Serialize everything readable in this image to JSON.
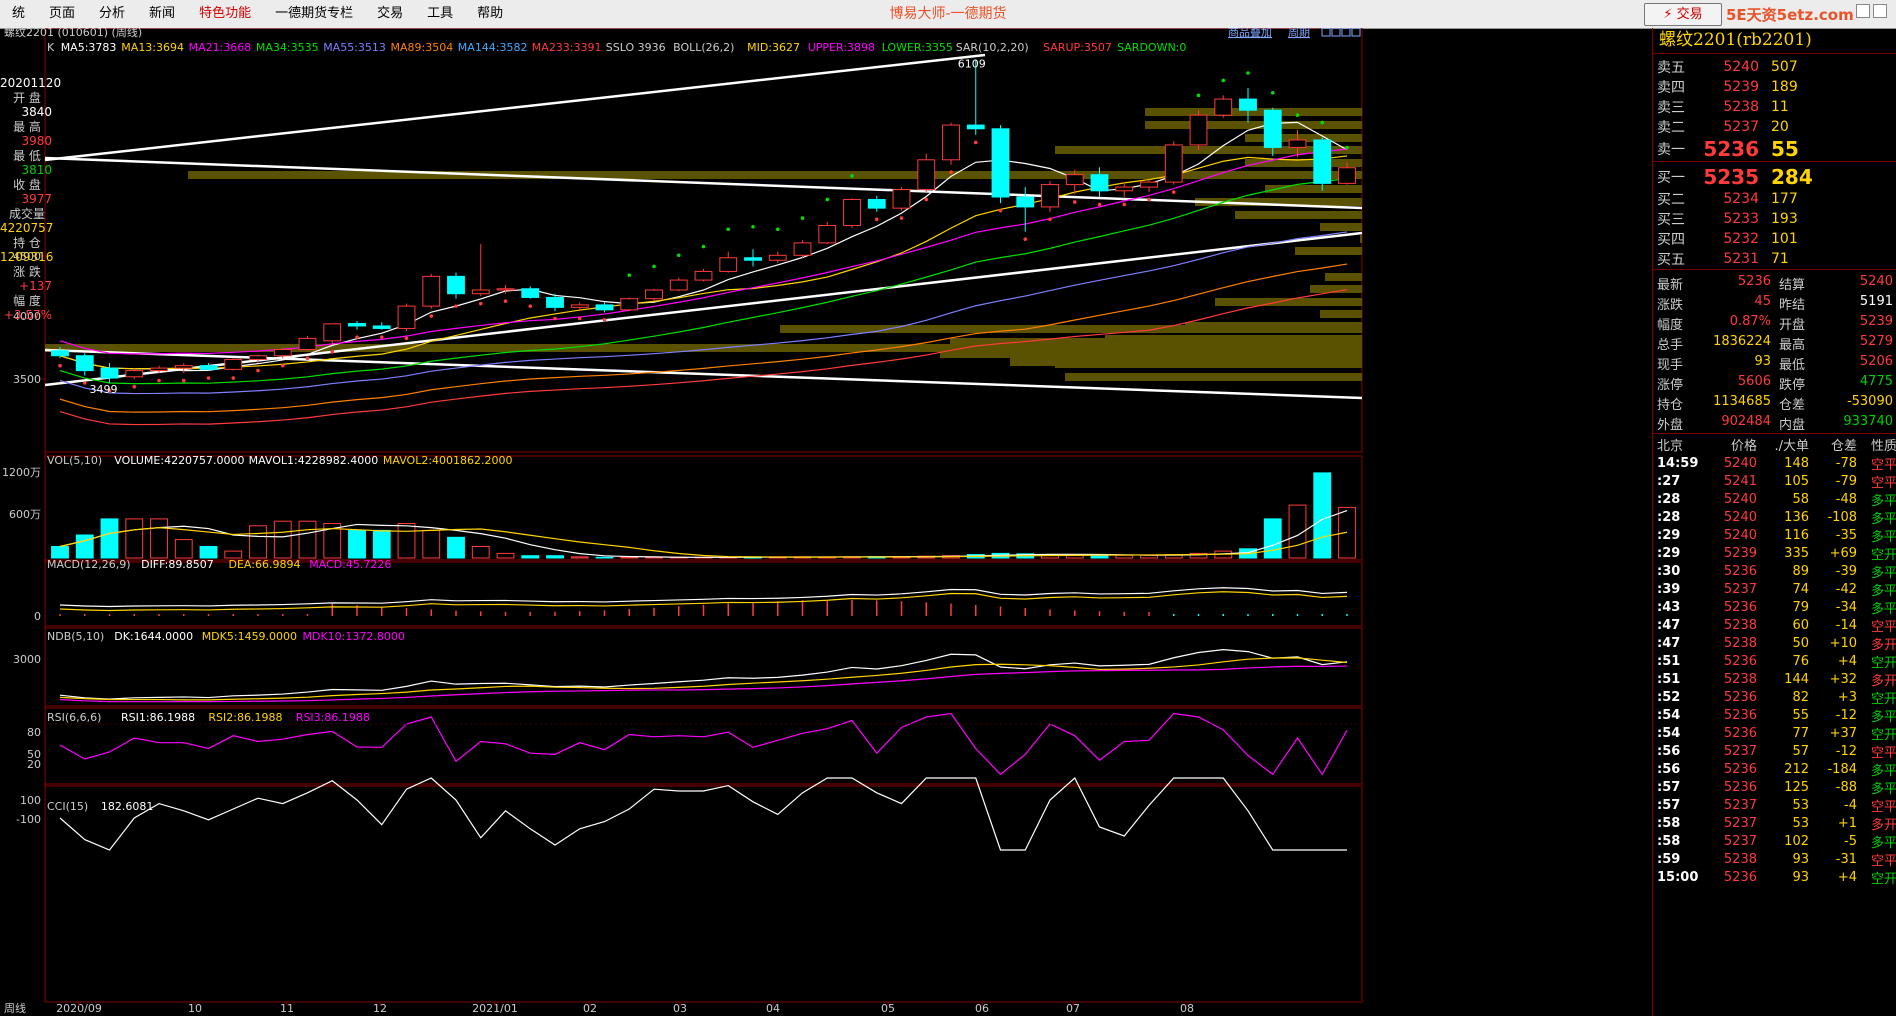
{
  "menu": {
    "items": [
      "统",
      "页面",
      "分析",
      "新闻",
      "特色功能",
      "一德期货专栏",
      "交易",
      "工具",
      "帮助"
    ],
    "app_title": "博易大师-一德期货",
    "trade_button": "交易",
    "watermark": "5E天资5etz.com"
  },
  "chart_header": {
    "title": "螺纹2201 (010601) (周线)",
    "links": [
      "商品叠加",
      "周期"
    ]
  },
  "ohlc": {
    "date": "20201120",
    "rows": [
      {
        "label": "开 盘",
        "value": "3840",
        "color": "#ffffff"
      },
      {
        "label": "最 高",
        "value": "3980",
        "color": "#ff3b3b"
      },
      {
        "label": "最 低",
        "value": "3810",
        "color": "#00d000"
      },
      {
        "label": "收 盘",
        "value": "3977",
        "color": "#ff3b3b"
      },
      {
        "label": "成交量",
        "value": "4220757",
        "color": "#ffd400"
      },
      {
        "label": "持 仓",
        "value": "1209316",
        "color": "#ffd400"
      },
      {
        "label": "涨 跌",
        "value": "+137",
        "color": "#ff3b3b"
      },
      {
        "label": "幅 度",
        "value": "+3.57%",
        "color": "#ff3b3b"
      }
    ]
  },
  "indicators": {
    "ma": [
      {
        "text": "K",
        "color": "#cccccc"
      },
      {
        "text": "MA5:3783",
        "color": "#ffffff"
      },
      {
        "text": "MA13:3694",
        "color": "#ffd400"
      },
      {
        "text": "MA21:3668",
        "color": "#ff00ff"
      },
      {
        "text": "MA34:3535",
        "color": "#00e000"
      },
      {
        "text": "MA55:3513",
        "color": "#7f7fff"
      },
      {
        "text": "MA89:3504",
        "color": "#ff8000"
      },
      {
        "text": "MA144:3582",
        "color": "#3fa9ff"
      },
      {
        "text": "MA233:3391",
        "color": "#ff3b3b"
      },
      {
        "text": "SSLO 3936",
        "color": "#cccccc"
      },
      {
        "text": "BOLL(26,2)",
        "color": "#cccccc"
      },
      {
        "text": "MID:3627",
        "color": "#ffd400"
      },
      {
        "text": "UPPER:3898",
        "color": "#ff00ff"
      },
      {
        "text": "LOWER:3355",
        "color": "#00e000"
      },
      {
        "text": "SAR(10,2,20)",
        "color": "#cccccc"
      },
      {
        "text": "SARUP:3507",
        "color": "#ff3b3b"
      },
      {
        "text": "SARDOWN:0",
        "color": "#00e000"
      }
    ],
    "vol": [
      {
        "text": "VOL(5,10)",
        "color": "#cccccc"
      },
      {
        "text": "VOLUME:4220757.0000",
        "color": "#ffffff"
      },
      {
        "text": "MAVOL1:4228982.4000",
        "color": "#ffffff"
      },
      {
        "text": "MAVOL2:4001862.2000",
        "color": "#ffd400"
      }
    ],
    "macd": [
      {
        "text": "MACD(12,26,9)",
        "color": "#cccccc"
      },
      {
        "text": "DIFF:89.8507",
        "color": "#ffffff"
      },
      {
        "text": "DEA:66.9894",
        "color": "#ffd400"
      },
      {
        "text": "MACD:45.7226",
        "color": "#ff00ff"
      }
    ],
    "ndb": [
      {
        "text": "NDB(5,10)",
        "color": "#cccccc"
      },
      {
        "text": "DK:1644.0000",
        "color": "#ffffff"
      },
      {
        "text": "MDK5:1459.0000",
        "color": "#ffd400"
      },
      {
        "text": "MDK10:1372.8000",
        "color": "#ff00ff"
      }
    ],
    "rsi": [
      {
        "text": "RSI(6,6,6)",
        "color": "#cccccc"
      },
      {
        "text": "RSI1:86.1988",
        "color": "#ffffff"
      },
      {
        "text": "RSI2:86.1988",
        "color": "#ffd400"
      },
      {
        "text": "RSI3:86.1988",
        "color": "#ff00ff"
      }
    ],
    "cci": [
      {
        "text": "CCI(15)",
        "color": "#cccccc"
      },
      {
        "text": "182.6081",
        "color": "#ffffff"
      }
    ]
  },
  "axes": {
    "price_ticks": [
      "4500",
      "4000",
      "3500"
    ],
    "vol_ticks": [
      "1200万",
      "600万"
    ],
    "macd_ticks": [
      "0"
    ],
    "ndb_ticks": [
      "3000"
    ],
    "rsi_ticks": [
      "80",
      "50",
      "20"
    ],
    "cci_ticks": [
      "100",
      "-100"
    ],
    "x_labels": [
      "2020/09",
      "10",
      "11",
      "12",
      "2021/01",
      "02",
      "03",
      "04",
      "05",
      "06",
      "07",
      "08"
    ],
    "period_label": "周线",
    "high_label": "6109",
    "low_label": "3499"
  },
  "quote": {
    "title": "螺纹2201(rb2201)",
    "asks": [
      {
        "label": "卖五",
        "price": "5240",
        "vol": "507"
      },
      {
        "label": "卖四",
        "price": "5239",
        "vol": "189"
      },
      {
        "label": "卖三",
        "price": "5238",
        "vol": "11"
      },
      {
        "label": "卖二",
        "price": "5237",
        "vol": "20"
      },
      {
        "label": "卖一",
        "price": "5236",
        "vol": "55"
      }
    ],
    "bids": [
      {
        "label": "买一",
        "price": "5235",
        "vol": "284"
      },
      {
        "label": "买二",
        "price": "5234",
        "vol": "177"
      },
      {
        "label": "买三",
        "price": "5233",
        "vol": "193"
      },
      {
        "label": "买四",
        "price": "5232",
        "vol": "101"
      },
      {
        "label": "买五",
        "price": "5231",
        "vol": "71"
      }
    ],
    "stats": [
      [
        {
          "k": "最新",
          "v": "5236",
          "c": "#ff3b3b"
        },
        {
          "k": "结算",
          "v": "5240",
          "c": "#ff3b3b"
        }
      ],
      [
        {
          "k": "涨跌",
          "v": "45",
          "c": "#ff3b3b"
        },
        {
          "k": "昨结",
          "v": "5191",
          "c": "#ffffff"
        }
      ],
      [
        {
          "k": "幅度",
          "v": "0.87%",
          "c": "#ff3b3b"
        },
        {
          "k": "开盘",
          "v": "5239",
          "c": "#ff3b3b"
        }
      ],
      [
        {
          "k": "总手",
          "v": "1836224",
          "c": "#ffd400"
        },
        {
          "k": "最高",
          "v": "5279",
          "c": "#ff3b3b"
        }
      ],
      [
        {
          "k": "现手",
          "v": "93",
          "c": "#ffd400"
        },
        {
          "k": "最低",
          "v": "5206",
          "c": "#ff3b3b"
        }
      ],
      [
        {
          "k": "涨停",
          "v": "5606",
          "c": "#ff3b3b"
        },
        {
          "k": "跌停",
          "v": "4775",
          "c": "#00d000"
        }
      ],
      [
        {
          "k": "持仓",
          "v": "1134685",
          "c": "#ffd400"
        },
        {
          "k": "仓差",
          "v": "-53090",
          "c": "#ffd400"
        }
      ],
      [
        {
          "k": "外盘",
          "v": "902484",
          "c": "#ff3b3b"
        },
        {
          "k": "内盘",
          "v": "933740",
          "c": "#00d000"
        }
      ]
    ],
    "tick_header": [
      "北京",
      "价格",
      "./大单",
      "仓差",
      "性质"
    ],
    "ticks": [
      {
        "t": "14:59",
        "p": "5240",
        "v": "148",
        "d": "-78",
        "n": "空平",
        "nc": "#ff3b3b"
      },
      {
        "t": ":27",
        "p": "5241",
        "v": "105",
        "d": "-79",
        "n": "空平",
        "nc": "#ff3b3b"
      },
      {
        "t": ":28",
        "p": "5240",
        "v": "58",
        "d": "-48",
        "n": "多平",
        "nc": "#00d000"
      },
      {
        "t": ":28",
        "p": "5240",
        "v": "136",
        "d": "-108",
        "n": "多平",
        "nc": "#00d000"
      },
      {
        "t": ":29",
        "p": "5240",
        "v": "116",
        "d": "-35",
        "n": "多平",
        "nc": "#00d000"
      },
      {
        "t": ":29",
        "p": "5239",
        "v": "335",
        "d": "+69",
        "n": "空开",
        "nc": "#00d000"
      },
      {
        "t": ":30",
        "p": "5236",
        "v": "89",
        "d": "-39",
        "n": "多平",
        "nc": "#00d000"
      },
      {
        "t": ":39",
        "p": "5237",
        "v": "74",
        "d": "-42",
        "n": "多平",
        "nc": "#00d000"
      },
      {
        "t": ":43",
        "p": "5236",
        "v": "79",
        "d": "-34",
        "n": "多平",
        "nc": "#00d000"
      },
      {
        "t": ":47",
        "p": "5238",
        "v": "60",
        "d": "-14",
        "n": "空平",
        "nc": "#ff3b3b"
      },
      {
        "t": ":47",
        "p": "5238",
        "v": "50",
        "d": "+10",
        "n": "多开",
        "nc": "#ff3b3b"
      },
      {
        "t": ":51",
        "p": "5236",
        "v": "76",
        "d": "+4",
        "n": "空开",
        "nc": "#00d000"
      },
      {
        "t": ":51",
        "p": "5238",
        "v": "144",
        "d": "+32",
        "n": "多开",
        "nc": "#ff3b3b"
      },
      {
        "t": ":52",
        "p": "5236",
        "v": "82",
        "d": "+3",
        "n": "空开",
        "nc": "#00d000"
      },
      {
        "t": ":54",
        "p": "5236",
        "v": "55",
        "d": "-12",
        "n": "多平",
        "nc": "#00d000"
      },
      {
        "t": ":54",
        "p": "5236",
        "v": "77",
        "d": "+37",
        "n": "空开",
        "nc": "#00d000"
      },
      {
        "t": ":56",
        "p": "5237",
        "v": "57",
        "d": "-12",
        "n": "空平",
        "nc": "#ff3b3b"
      },
      {
        "t": ":56",
        "p": "5236",
        "v": "212",
        "d": "-184",
        "n": "多平",
        "nc": "#00d000"
      },
      {
        "t": ":57",
        "p": "5236",
        "v": "125",
        "d": "-88",
        "n": "多平",
        "nc": "#00d000"
      },
      {
        "t": ":57",
        "p": "5237",
        "v": "53",
        "d": "-4",
        "n": "空平",
        "nc": "#ff3b3b"
      },
      {
        "t": ":58",
        "p": "5237",
        "v": "53",
        "d": "+1",
        "n": "多开",
        "nc": "#ff3b3b"
      },
      {
        "t": ":58",
        "p": "5237",
        "v": "102",
        "d": "-5",
        "n": "多平",
        "nc": "#00d000"
      },
      {
        "t": ":59",
        "p": "5238",
        "v": "93",
        "d": "-31",
        "n": "空平",
        "nc": "#ff3b3b"
      },
      {
        "t": "15:00",
        "p": "5236",
        "v": "93",
        "d": "+4",
        "n": "空开",
        "nc": "#00d000"
      }
    ]
  },
  "chart_data": {
    "type": "candlestick",
    "period": "周线",
    "price_axis": [
      3500,
      4000,
      4500
    ],
    "candles": [
      {
        "o": 3760,
        "h": 3790,
        "l": 3700,
        "c": 3720
      },
      {
        "o": 3720,
        "h": 3740,
        "l": 3560,
        "c": 3600
      },
      {
        "o": 3620,
        "h": 3660,
        "l": 3499,
        "c": 3540
      },
      {
        "o": 3550,
        "h": 3620,
        "l": 3530,
        "c": 3600
      },
      {
        "o": 3600,
        "h": 3640,
        "l": 3580,
        "c": 3620
      },
      {
        "o": 3620,
        "h": 3660,
        "l": 3580,
        "c": 3640
      },
      {
        "o": 3640,
        "h": 3660,
        "l": 3600,
        "c": 3610
      },
      {
        "o": 3610,
        "h": 3700,
        "l": 3600,
        "c": 3690
      },
      {
        "o": 3690,
        "h": 3730,
        "l": 3660,
        "c": 3720
      },
      {
        "o": 3720,
        "h": 3780,
        "l": 3700,
        "c": 3770
      },
      {
        "o": 3770,
        "h": 3880,
        "l": 3760,
        "c": 3860
      },
      {
        "o": 3840,
        "h": 3980,
        "l": 3810,
        "c": 3977
      },
      {
        "o": 3980,
        "h": 4000,
        "l": 3930,
        "c": 3960
      },
      {
        "o": 3960,
        "h": 3990,
        "l": 3930,
        "c": 3940
      },
      {
        "o": 3940,
        "h": 4140,
        "l": 3920,
        "c": 4120
      },
      {
        "o": 4120,
        "h": 4380,
        "l": 4100,
        "c": 4360
      },
      {
        "o": 4360,
        "h": 4390,
        "l": 4180,
        "c": 4220
      },
      {
        "o": 4220,
        "h": 4620,
        "l": 4200,
        "c": 4250
      },
      {
        "o": 4250,
        "h": 4290,
        "l": 4220,
        "c": 4260
      },
      {
        "o": 4260,
        "h": 4280,
        "l": 4180,
        "c": 4190
      },
      {
        "o": 4190,
        "h": 4220,
        "l": 4080,
        "c": 4110
      },
      {
        "o": 4110,
        "h": 4150,
        "l": 4080,
        "c": 4130
      },
      {
        "o": 4130,
        "h": 4150,
        "l": 4070,
        "c": 4090
      },
      {
        "o": 4090,
        "h": 4190,
        "l": 4080,
        "c": 4180
      },
      {
        "o": 4180,
        "h": 4260,
        "l": 4160,
        "c": 4250
      },
      {
        "o": 4250,
        "h": 4350,
        "l": 4240,
        "c": 4330
      },
      {
        "o": 4330,
        "h": 4420,
        "l": 4320,
        "c": 4400
      },
      {
        "o": 4400,
        "h": 4560,
        "l": 4390,
        "c": 4510
      },
      {
        "o": 4510,
        "h": 4580,
        "l": 4440,
        "c": 4490
      },
      {
        "o": 4490,
        "h": 4560,
        "l": 4470,
        "c": 4530
      },
      {
        "o": 4530,
        "h": 4650,
        "l": 4510,
        "c": 4630
      },
      {
        "o": 4630,
        "h": 4800,
        "l": 4620,
        "c": 4770
      },
      {
        "o": 4770,
        "h": 4990,
        "l": 4750,
        "c": 4980
      },
      {
        "o": 4980,
        "h": 5010,
        "l": 4880,
        "c": 4910
      },
      {
        "o": 4910,
        "h": 5080,
        "l": 4890,
        "c": 5060
      },
      {
        "o": 5060,
        "h": 5350,
        "l": 5040,
        "c": 5300
      },
      {
        "o": 5300,
        "h": 5600,
        "l": 5260,
        "c": 5580
      },
      {
        "o": 5580,
        "h": 6109,
        "l": 5500,
        "c": 5550
      },
      {
        "o": 5550,
        "h": 5580,
        "l": 4950,
        "c": 5000
      },
      {
        "o": 5000,
        "h": 5080,
        "l": 4720,
        "c": 4920
      },
      {
        "o": 4920,
        "h": 5130,
        "l": 4880,
        "c": 5100
      },
      {
        "o": 5100,
        "h": 5220,
        "l": 5020,
        "c": 5180
      },
      {
        "o": 5180,
        "h": 5240,
        "l": 5000,
        "c": 5050
      },
      {
        "o": 5050,
        "h": 5120,
        "l": 5000,
        "c": 5080
      },
      {
        "o": 5080,
        "h": 5140,
        "l": 5040,
        "c": 5120
      },
      {
        "o": 5120,
        "h": 5450,
        "l": 5100,
        "c": 5420
      },
      {
        "o": 5420,
        "h": 5700,
        "l": 5380,
        "c": 5660
      },
      {
        "o": 5660,
        "h": 5820,
        "l": 5640,
        "c": 5790
      },
      {
        "o": 5790,
        "h": 5880,
        "l": 5600,
        "c": 5700
      },
      {
        "o": 5700,
        "h": 5720,
        "l": 5330,
        "c": 5400
      },
      {
        "o": 5400,
        "h": 5540,
        "l": 5320,
        "c": 5460
      },
      {
        "o": 5460,
        "h": 5480,
        "l": 5050,
        "c": 5110
      },
      {
        "o": 5110,
        "h": 5279,
        "l": 5100,
        "c": 5236
      }
    ]
  }
}
